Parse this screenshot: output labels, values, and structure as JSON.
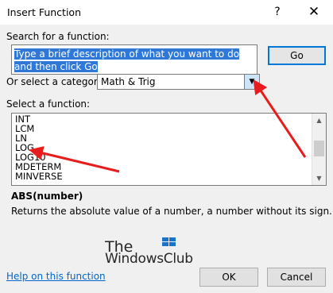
{
  "dialog": {
    "title": "Insert Function",
    "help_glyph": "?",
    "close_glyph": "✕"
  },
  "search": {
    "label": "Search for a function:",
    "value": "Type a brief description of what you want to do and then click Go",
    "go_label": "Go"
  },
  "category": {
    "label": "Or select a category:",
    "value": "Math & Trig",
    "dropdown_glyph": "▼"
  },
  "functions": {
    "label": "Select a function:",
    "items": [
      "INT",
      "LCM",
      "LN",
      "LOG",
      "LOG10",
      "MDETERM",
      "MINVERSE"
    ],
    "scroll_up_glyph": "▲",
    "scroll_down_glyph": "▼"
  },
  "details": {
    "signature": "ABS(number)",
    "description": "Returns the absolute value of a number, a number without its sign."
  },
  "watermark": {
    "line1": "The",
    "line2": "WindowsClub"
  },
  "footer": {
    "help_link": "Help on this function",
    "ok_label": "OK",
    "cancel_label": "Cancel"
  },
  "colors": {
    "accent": "#0078d7",
    "arrow": "#e81c1c",
    "selection": "#3078d7",
    "link": "#0066cc"
  }
}
